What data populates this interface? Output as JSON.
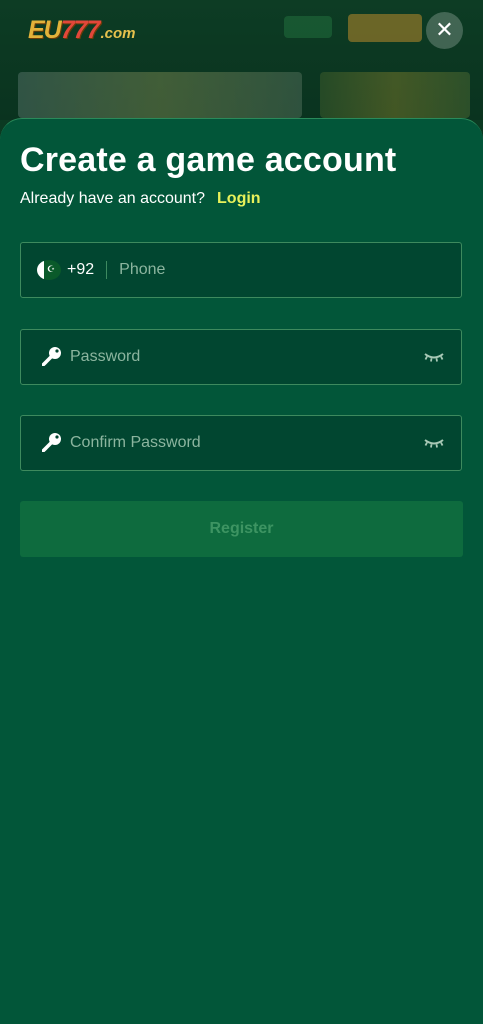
{
  "header": {
    "logo_main": "EU",
    "logo_sevens": "777",
    "logo_suffix": ".com",
    "close_icon": "close-icon"
  },
  "form": {
    "title": "Create a game account",
    "have_account_text": "Already have an account?",
    "login_label": "Login",
    "phone": {
      "country_flag": "pakistan-flag-icon",
      "country_code": "+92",
      "placeholder": "Phone",
      "value": ""
    },
    "password": {
      "icon": "key-icon",
      "placeholder": "Password",
      "value": "",
      "toggle_icon": "eye-closed-icon"
    },
    "confirm_password": {
      "icon": "key-icon",
      "placeholder": "Confirm Password",
      "value": "",
      "toggle_icon": "eye-closed-icon"
    },
    "register_label": "Register"
  },
  "colors": {
    "sheet_bg": "#025639",
    "field_bg": "#014630",
    "field_border": "#3e8a5e",
    "login_link": "#e8f15a",
    "register_disabled_bg": "#0e6b3e",
    "register_disabled_text": "#3d9462"
  }
}
